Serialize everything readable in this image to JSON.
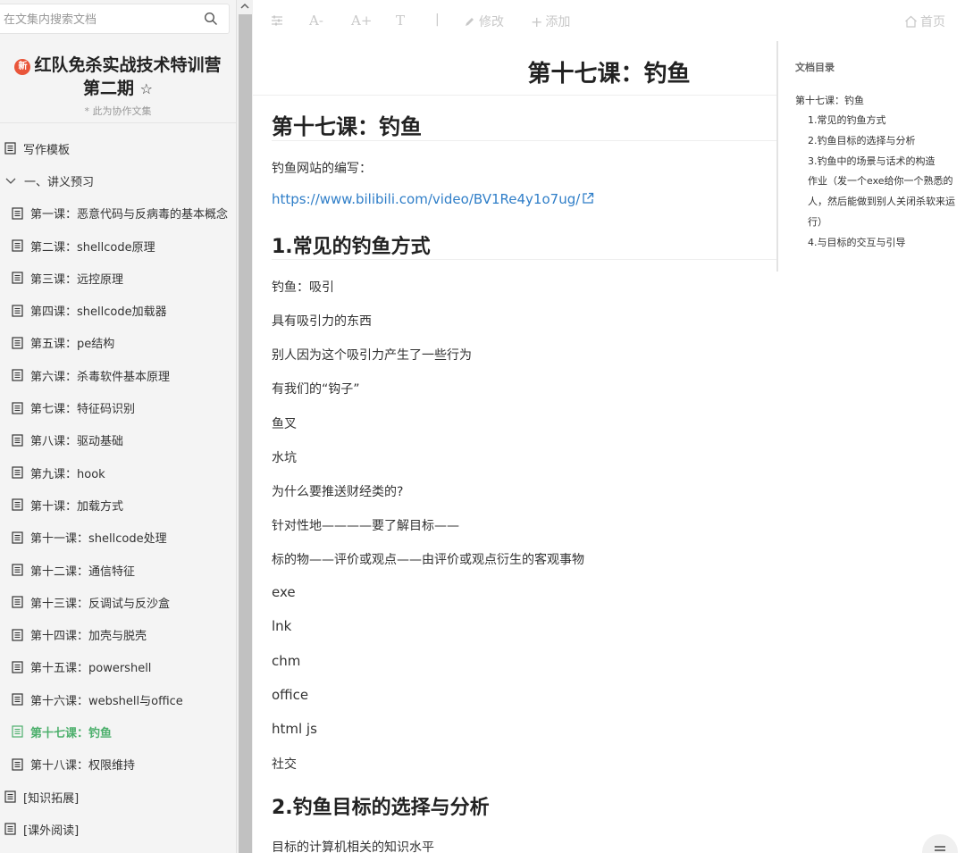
{
  "search": {
    "placeholder": "在文集内搜索文档"
  },
  "book": {
    "badge": "新",
    "title": "红队免杀实战技术特训营 第二期",
    "star": "☆",
    "subtitle": "* 此为协作文集"
  },
  "sidebar": {
    "items": [
      {
        "label": "写作模板",
        "type": "doc"
      },
      {
        "label": "一、讲义预习",
        "type": "folder"
      },
      {
        "label": "第一课：恶意代码与反病毒的基本概念",
        "type": "doc"
      },
      {
        "label": "第二课：shellcode原理",
        "type": "doc"
      },
      {
        "label": "第三课：远控原理",
        "type": "doc"
      },
      {
        "label": "第四课：shellcode加载器",
        "type": "doc"
      },
      {
        "label": "第五课：pe结构",
        "type": "doc"
      },
      {
        "label": "第六课：杀毒软件基本原理",
        "type": "doc"
      },
      {
        "label": "第七课：特征码识别",
        "type": "doc"
      },
      {
        "label": "第八课：驱动基础",
        "type": "doc"
      },
      {
        "label": "第九课：hook",
        "type": "doc"
      },
      {
        "label": "第十课：加载方式",
        "type": "doc"
      },
      {
        "label": "第十一课：shellcode处理",
        "type": "doc"
      },
      {
        "label": "第十二课：通信特征",
        "type": "doc"
      },
      {
        "label": "第十三课：反调试与反沙盒",
        "type": "doc"
      },
      {
        "label": "第十四课：加壳与脱壳",
        "type": "doc"
      },
      {
        "label": "第十五课：powershell",
        "type": "doc"
      },
      {
        "label": "第十六课：webshell与office",
        "type": "doc"
      },
      {
        "label": "第十七课：钓鱼",
        "type": "doc"
      },
      {
        "label": "第十八课：权限维持",
        "type": "doc"
      },
      {
        "label": "[知识拓展]",
        "type": "doc"
      },
      {
        "label": "[课外阅读]",
        "type": "doc"
      }
    ]
  },
  "toolbar": {
    "font_smaller": "A-",
    "font_larger": "A+",
    "font_toggle": "T",
    "divider": "|",
    "edit": "修改",
    "add": "添加",
    "home": "首页"
  },
  "doc": {
    "page_title": "第十七课：钓鱼",
    "h1": "第十七课：钓鱼",
    "intro": "钓鱼网站的编写：",
    "link": "https://www.bilibili.com/video/BV1Re4y1o7ug/",
    "section1": "1.常见的钓鱼方式",
    "paragraphs": [
      "钓鱼：吸引",
      "具有吸引力的东西",
      "别人因为这个吸引力产生了一些行为",
      "有我们的“钩子”",
      "鱼叉",
      "水坑",
      "为什么要推送财经类的?",
      "针对性地————要了解目标——",
      "标的物——评价或观点——由评价或观点衍生的客观事物",
      "exe",
      "lnk",
      "chm",
      "office",
      "html js",
      "社交"
    ],
    "section2": "2.钓鱼目标的选择与分析",
    "last_para": "目标的计算机相关的知识水平"
  },
  "toc": {
    "title": "文档目录",
    "items": [
      "第十七课：钓鱼",
      "1.常见的钓鱼方式",
      "2.钓鱼目标的选择与分析",
      "3.钓鱼中的场景与话术的构造",
      "作业（发一个exe给你一个熟悉的",
      "人，然后能做到别人关闭杀软来运",
      "行）",
      "4.与目标的交互与引导"
    ]
  },
  "colors": {
    "active": "#4caf6c",
    "link": "#2f7ec8",
    "badge": "#e9553a"
  },
  "icons": {
    "search": "search-icon",
    "doc": "document-icon",
    "chevron": "chevron-down-icon",
    "external": "external-link-icon"
  }
}
